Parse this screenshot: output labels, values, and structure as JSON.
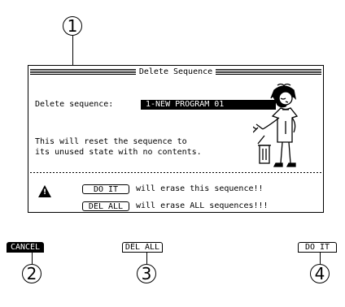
{
  "callouts": [
    "1",
    "2",
    "3",
    "4"
  ],
  "dialog": {
    "title": "Delete Sequence",
    "delete_label": "Delete sequence:",
    "sequence_value": "1-NEW PROGRAM 01",
    "message_line1": "This will reset the sequence to",
    "message_line2": "its unused state with no contents.",
    "do_it_key": "DO IT",
    "do_it_text": "will erase this sequence!!",
    "del_all_key": "DEL ALL",
    "del_all_text": "will erase ALL sequences!!!",
    "warning_icon": "warning-triangle-icon"
  },
  "softkeys": {
    "cancel": "CANCEL",
    "del_all": "DEL ALL",
    "do_it": "DO IT"
  }
}
